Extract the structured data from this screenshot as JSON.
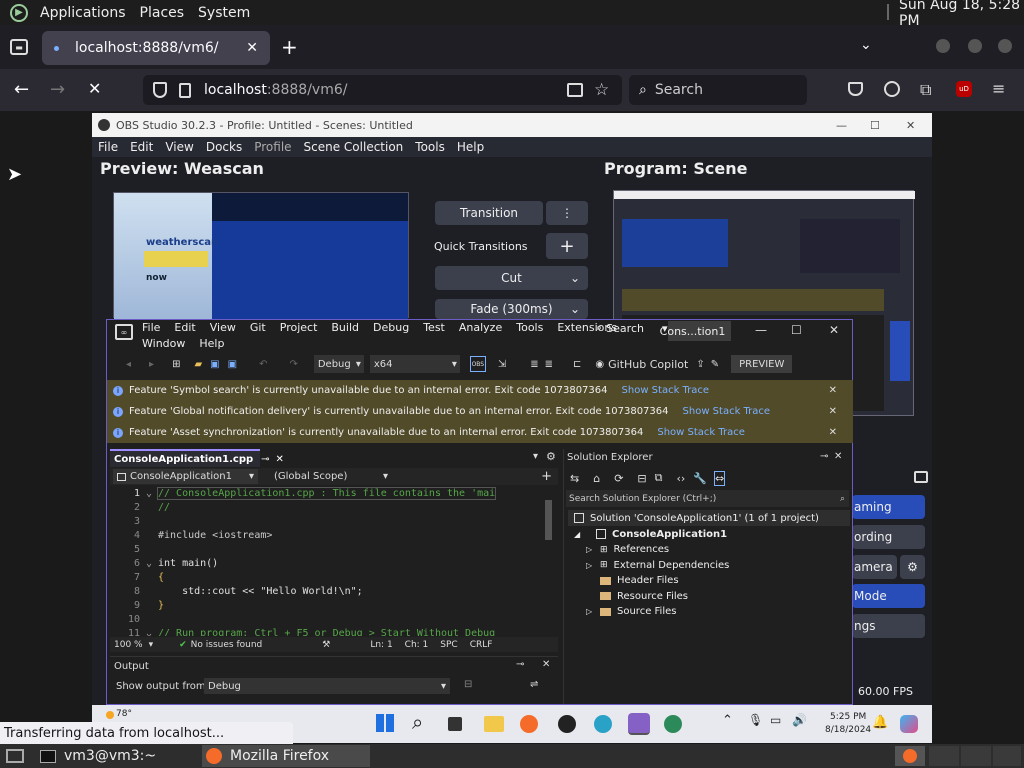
{
  "gnome": {
    "menu": [
      "Applications",
      "Places",
      "System"
    ],
    "clock": "Sun Aug 18,  5:28 PM"
  },
  "browser": {
    "tab_title": "localhost:8888/vm6/",
    "url_host": "localhost",
    "url_path": ":8888/vm6/",
    "search_placeholder": "Search",
    "status": "Transferring data from localhost..."
  },
  "obs": {
    "title": "OBS Studio 30.2.3 - Profile: Untitled - Scenes: Untitled",
    "menu": [
      "File",
      "Edit",
      "View",
      "Docks",
      "Profile",
      "Scene Collection",
      "Tools",
      "Help"
    ],
    "preview_label": "Preview: Weascan",
    "program_label": "Program: Scene",
    "transition": "Transition",
    "quick_transitions": "Quick Transitions",
    "cut": "Cut",
    "fade": "Fade (300ms)",
    "controls": [
      "aming",
      "ording",
      "amera",
      "Mode",
      "ngs"
    ],
    "fps": "60.00 FPS",
    "weatherscan_text": "weatherscan",
    "now_text": "now"
  },
  "vs": {
    "menu1": [
      "File",
      "Edit",
      "View",
      "Git",
      "Project",
      "Build",
      "Debug",
      "Test",
      "Analyze",
      "Tools",
      "Extensions"
    ],
    "menu2": [
      "Window",
      "Help"
    ],
    "search": "Search",
    "solution_short": "Cons...tion1",
    "config": "Debug",
    "platform": "x64",
    "copilot": "GitHub Copilot",
    "preview": "PREVIEW",
    "warnings": [
      {
        "text": "Feature 'Symbol search' is currently unavailable due to an internal error. Exit code 1073807364",
        "link": "Show Stack Trace"
      },
      {
        "text": "Feature 'Global notification delivery' is currently unavailable due to an internal error. Exit code 1073807364",
        "link": "Show Stack Trace"
      },
      {
        "text": "Feature 'Asset synchronization' is currently unavailable due to an internal error. Exit code 1073807364",
        "link": "Show Stack Trace"
      }
    ],
    "file_tab": "ConsoleApplication1.cpp",
    "scope_project": "ConsoleApplication1",
    "scope": "(Global Scope)",
    "code_lines": [
      {
        "n": "1",
        "t": "// ConsoleApplication1.cpp : This file contains the 'mai"
      },
      {
        "n": "2",
        "t": "//"
      },
      {
        "n": "3",
        "t": ""
      },
      {
        "n": "4",
        "t": "#include <iostream>"
      },
      {
        "n": "5",
        "t": ""
      },
      {
        "n": "6",
        "t": "int main()"
      },
      {
        "n": "7",
        "t": "{"
      },
      {
        "n": "8",
        "t": "    std::cout << \"Hello World!\\n\";"
      },
      {
        "n": "9",
        "t": "}"
      },
      {
        "n": "10",
        "t": ""
      },
      {
        "n": "11",
        "t": "// Run program: Ctrl + F5 or Debug > Start Without Debug"
      }
    ],
    "zoom": "100 %",
    "issues": "No issues found",
    "ln": "Ln: 1",
    "ch": "Ch: 1",
    "spc": "SPC",
    "crlf": "CRLF",
    "output_title": "Output",
    "show_output": "Show output from:",
    "output_source": "Debug",
    "se_title": "Solution Explorer",
    "se_search": "Search Solution Explorer (Ctrl+;)",
    "se_items": [
      {
        "label": "Solution 'ConsoleApplication1' (1 of 1 project)",
        "indent": 0
      },
      {
        "label": "ConsoleApplication1",
        "indent": 1,
        "bold": true
      },
      {
        "label": "References",
        "indent": 2
      },
      {
        "label": "External Dependencies",
        "indent": 2
      },
      {
        "label": "Header Files",
        "indent": 2
      },
      {
        "label": "Resource Files",
        "indent": 2
      },
      {
        "label": "Source Files",
        "indent": 2
      }
    ]
  },
  "win_taskbar": {
    "weather": "78°",
    "time": "5:25 PM",
    "date": "8/18/2024"
  },
  "bottom": {
    "terminal": "vm3@vm3:~",
    "firefox": "Mozilla Firefox"
  }
}
